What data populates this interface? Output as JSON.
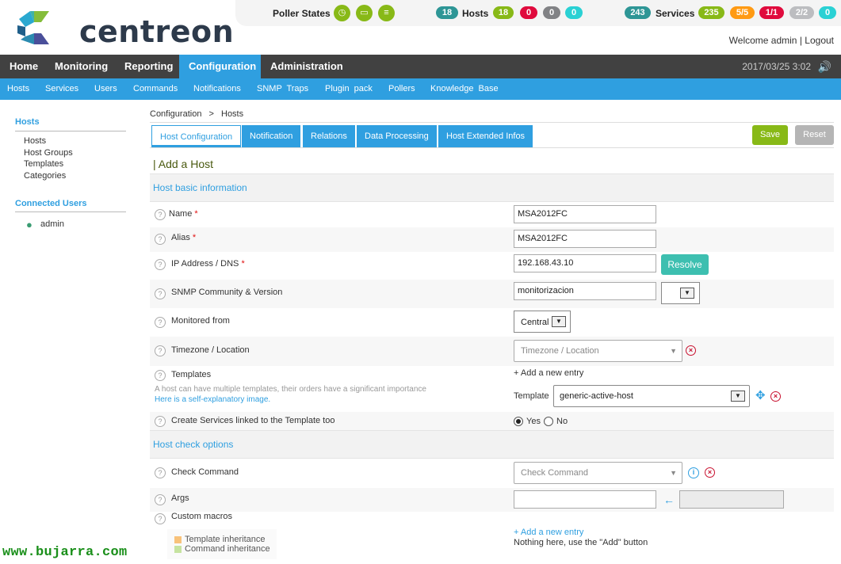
{
  "brand": {
    "name": "centreon"
  },
  "poller": {
    "label": "Poller States"
  },
  "hosts": {
    "total": "18",
    "label": "Hosts",
    "up": "18",
    "down": "0",
    "unreachable": "0",
    "pending": "0"
  },
  "services": {
    "total": "243",
    "label": "Services",
    "ok": "235",
    "warning": "5/5",
    "critical": "1/1",
    "unknown": "2/2",
    "pending": "0"
  },
  "user": {
    "welcome": "Welcome admin",
    "sep": "|",
    "logout": "Logout"
  },
  "topnav": {
    "items": [
      "Home",
      "Monitoring",
      "Reporting",
      "Configuration",
      "Administration"
    ],
    "active": "Configuration",
    "clock": "2017/03/25 3:02"
  },
  "subnav": {
    "items": [
      "Hosts",
      "Services",
      "Users",
      "Commands",
      "Notifications",
      "SNMP Traps",
      "Plugin pack",
      "Pollers",
      "Knowledge Base"
    ]
  },
  "sidebar": {
    "hosts_title": "Hosts",
    "items": [
      "Hosts",
      "Host Groups",
      "Templates",
      "Categories"
    ],
    "connected_title": "Connected Users",
    "users": [
      "admin"
    ]
  },
  "watermark": "www.bujarra.com",
  "breadcrumb": {
    "root": "Configuration",
    "sep": ">",
    "current": "Hosts"
  },
  "tabs": [
    "Host Configuration",
    "Notification",
    "Relations",
    "Data Processing",
    "Host Extended Infos"
  ],
  "buttons": {
    "save": "Save",
    "reset": "Reset",
    "resolve": "Resolve"
  },
  "page": {
    "title": "| Add a Host"
  },
  "sections": {
    "basic": "Host basic information",
    "check": "Host check options"
  },
  "form": {
    "name": {
      "label": "Name",
      "required": "*",
      "value": "MSA2012FC"
    },
    "alias": {
      "label": "Alias",
      "required": "*",
      "value": "MSA2012FC"
    },
    "ip": {
      "label": "IP Address / DNS",
      "required": "*",
      "value": "192.168.43.10"
    },
    "snmp": {
      "label": "SNMP Community & Version",
      "value": "monitorizacion"
    },
    "monitored": {
      "label": "Monitored from",
      "value": "Central"
    },
    "timezone": {
      "label": "Timezone / Location",
      "placeholder": "Timezone / Location"
    },
    "templates": {
      "label": "Templates",
      "hint": "A host can have multiple templates, their orders have a significant importance",
      "link": "Here is a self-explanatory image.",
      "add": "+ Add a new entry",
      "template_label": "Template",
      "template_value": "generic-active-host"
    },
    "create_services": {
      "label": "Create Services linked to the Template too",
      "yes": "Yes",
      "no": "No"
    },
    "check_command": {
      "label": "Check Command",
      "placeholder": "Check Command"
    },
    "args": {
      "label": "Args"
    },
    "macros": {
      "label": "Custom macros",
      "add": "+ Add a new entry",
      "empty": "Nothing here, use the \"Add\" button",
      "legend_template": "Template inheritance",
      "legend_command": "Command inheritance"
    }
  },
  "colors": {
    "nav": "#414141",
    "accent": "#2f9fe0",
    "ok": "#88b917",
    "critical": "#e00b3d",
    "warning": "#ff9a13",
    "unknown": "#bcbdc0",
    "pending": "#2ad1d4"
  }
}
